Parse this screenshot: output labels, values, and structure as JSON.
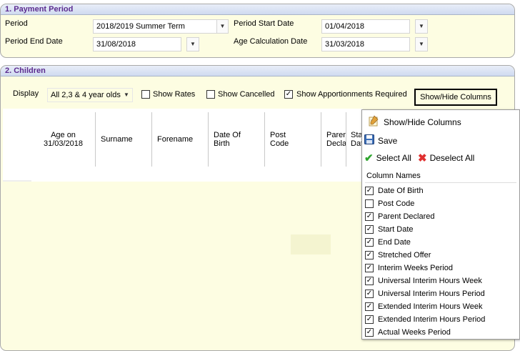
{
  "payment_period": {
    "title": "1. Payment Period",
    "period_label": "Period",
    "period_value": "2018/2019 Summer Term",
    "start_label": "Period Start Date",
    "start_value": "01/04/2018",
    "end_label": "Period End Date",
    "end_value": "31/08/2018",
    "age_calc_label": "Age Calculation Date",
    "age_calc_value": "31/03/2018"
  },
  "children": {
    "title": "2. Children",
    "display_label": "Display",
    "display_value": "All 2,3 & 4 year olds",
    "show_rates_label": "Show Rates",
    "show_rates_checked": false,
    "show_cancelled_label": "Show Cancelled",
    "show_cancelled_checked": false,
    "show_apportionments_label": "Show Apportionments Required",
    "show_apportionments_checked": true,
    "show_hide_button": "Show/Hide Columns",
    "columns": {
      "age_line1": "Age on",
      "age_line2": "31/03/2018",
      "surname": "Surname",
      "forename": "Forename",
      "dob_line1": "Date Of",
      "dob_line2": "Birth",
      "post_line1": "Post",
      "post_line2": "Code",
      "parent_line1": "Parent",
      "parent_line2": "Declared",
      "start_line1": "Start",
      "start_line2": "Date"
    }
  },
  "popup": {
    "title": "Show/Hide Columns",
    "save_label": "Save",
    "select_all_label": "Select All",
    "deselect_all_label": "Deselect All",
    "column_names_label": "Column Names",
    "columns": [
      {
        "label": "Date Of Birth",
        "checked": true
      },
      {
        "label": "Post Code",
        "checked": false
      },
      {
        "label": "Parent Declared",
        "checked": true
      },
      {
        "label": "Start Date",
        "checked": true
      },
      {
        "label": "End Date",
        "checked": true
      },
      {
        "label": "Stretched Offer",
        "checked": true
      },
      {
        "label": "Interim Weeks Period",
        "checked": true
      },
      {
        "label": "Universal Interim Hours Week",
        "checked": true
      },
      {
        "label": "Universal Interim Hours Period",
        "checked": true
      },
      {
        "label": "Extended Interim Hours Week",
        "checked": true
      },
      {
        "label": "Extended Interim Hours Period",
        "checked": true
      },
      {
        "label": "Actual Weeks Period",
        "checked": true
      }
    ]
  },
  "icons": {
    "dropdown": "dropdown-arrow-icon",
    "edit": "edit-icon",
    "save": "floppy-disk-icon",
    "select_all": "green-check-icon",
    "deselect_all": "red-x-icon"
  },
  "colors": {
    "panel_background": "#fdfde2",
    "header_text": "#5b2b8f",
    "header_gradient_top": "#e9eef8",
    "header_gradient_bottom": "#cfdaf0"
  }
}
